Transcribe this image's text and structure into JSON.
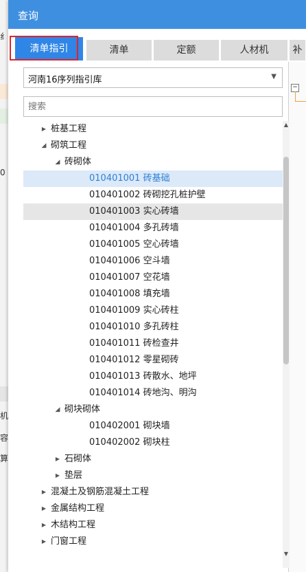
{
  "background": {
    "chars": [
      {
        "id": "bg-char-1",
        "text": "纟"
      },
      {
        "id": "bg-char-2",
        "text": "0"
      },
      {
        "id": "bg-char-3",
        "text": "机"
      },
      {
        "id": "bg-char-4",
        "text": "容"
      },
      {
        "id": "bg-char-5",
        "text": "算"
      }
    ]
  },
  "dialog": {
    "title": "查询",
    "tabs": [
      {
        "label": "清单指引",
        "active": true
      },
      {
        "label": "清单",
        "active": false
      },
      {
        "label": "定额",
        "active": false
      },
      {
        "label": "人材机",
        "active": false
      },
      {
        "label": "补",
        "active": false
      }
    ],
    "library_select": {
      "value": "河南16序列指引库"
    },
    "search": {
      "placeholder": "搜索"
    },
    "right_panel": {
      "toggle": "−"
    },
    "tree": [
      {
        "label": "桩基工程",
        "level": 1,
        "state": "collapsed"
      },
      {
        "label": "砌筑工程",
        "level": 1,
        "state": "expanded"
      },
      {
        "label": "砖砌体",
        "level": 2,
        "state": "expanded"
      },
      {
        "label": "010401001  砖基础",
        "level": 3,
        "state": "leaf",
        "selected": true
      },
      {
        "label": "010401002  砖砌挖孔桩护壁",
        "level": 3,
        "state": "leaf"
      },
      {
        "label": "010401003  实心砖墙",
        "level": 3,
        "state": "leaf",
        "hover": true
      },
      {
        "label": "010401004  多孔砖墙",
        "level": 3,
        "state": "leaf"
      },
      {
        "label": "010401005  空心砖墙",
        "level": 3,
        "state": "leaf"
      },
      {
        "label": "010401006  空斗墙",
        "level": 3,
        "state": "leaf"
      },
      {
        "label": "010401007  空花墙",
        "level": 3,
        "state": "leaf"
      },
      {
        "label": "010401008  填充墙",
        "level": 3,
        "state": "leaf"
      },
      {
        "label": "010401009  实心砖柱",
        "level": 3,
        "state": "leaf"
      },
      {
        "label": "010401010  多孔砖柱",
        "level": 3,
        "state": "leaf"
      },
      {
        "label": "010401011  砖检查井",
        "level": 3,
        "state": "leaf"
      },
      {
        "label": "010401012  零星砌砖",
        "level": 3,
        "state": "leaf"
      },
      {
        "label": "010401013  砖散水、地坪",
        "level": 3,
        "state": "leaf"
      },
      {
        "label": "010401014  砖地沟、明沟",
        "level": 3,
        "state": "leaf"
      },
      {
        "label": "砌块砌体",
        "level": 2,
        "state": "expanded"
      },
      {
        "label": "010402001  砌块墙",
        "level": 3,
        "state": "leaf"
      },
      {
        "label": "010402002  砌块柱",
        "level": 3,
        "state": "leaf"
      },
      {
        "label": "石砌体",
        "level": 2,
        "state": "collapsed"
      },
      {
        "label": "垫层",
        "level": 2,
        "state": "collapsed"
      },
      {
        "label": "混凝土及钢筋混凝土工程",
        "level": 1,
        "state": "collapsed"
      },
      {
        "label": "金属结构工程",
        "level": 1,
        "state": "collapsed"
      },
      {
        "label": "木结构工程",
        "level": 1,
        "state": "collapsed"
      },
      {
        "label": "门窗工程",
        "level": 1,
        "state": "collapsed"
      }
    ]
  },
  "colors": {
    "titlebar": "#3f8fe0",
    "active_tab": "#2f86e6",
    "selection_bg": "#dbe9f8",
    "selection_text": "#2f7fd6",
    "highlight_border": "#e0242a"
  }
}
